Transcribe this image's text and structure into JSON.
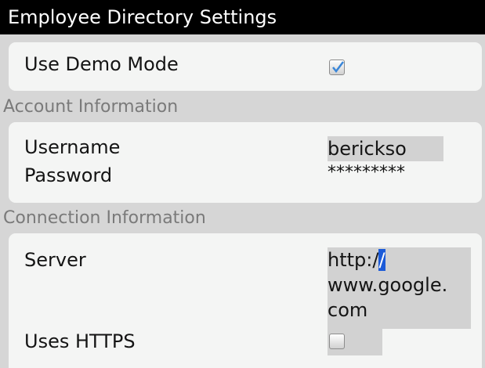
{
  "title": "Employee Directory Settings",
  "demo": {
    "label": "Use Demo Mode",
    "checked": true
  },
  "account": {
    "header": "Account Information",
    "username_label": "Username",
    "username_value": "bericksо",
    "password_label": "Password",
    "password_value": "*********"
  },
  "connection": {
    "header": "Connection Information",
    "server_label": "Server",
    "server_value_line1_prefix": "http:/",
    "server_value_line1_cursor": "/",
    "server_value_line2": "www.google.",
    "server_value_line3": "com",
    "https_label": "Uses HTTPS",
    "https_checked": false
  },
  "colors": {
    "title_bg": "#000000",
    "panel_bg": "#f4f5f4",
    "section_bg": "#d6d6d6",
    "field_bg": "#d2d2d2",
    "selection": "#1c5bd8"
  }
}
